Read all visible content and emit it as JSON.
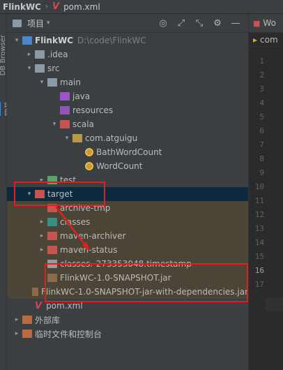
{
  "breadcrumb": {
    "project": "FlinkWC",
    "separator": "›",
    "file": "pom.xml"
  },
  "leftstrip": {
    "db_browser": "DB Browser",
    "project_tab": "项目"
  },
  "panel": {
    "title": "项目",
    "icons": [
      "target-icon",
      "expand-icon",
      "collapse-icon",
      "gear-icon",
      "hide-icon"
    ]
  },
  "tree": [
    {
      "arrow": "▾",
      "icon": "folder-blue",
      "label": "FlinkWC",
      "extra": "D:\\code\\FlinkWC",
      "bold": true,
      "indent": 0,
      "name": "tree-item-flinkwc"
    },
    {
      "arrow": "▸",
      "icon": "folder-grey",
      "label": ".idea",
      "indent": 1,
      "name": "tree-item-idea"
    },
    {
      "arrow": "▾",
      "icon": "folder-grey",
      "label": "src",
      "indent": 1,
      "name": "tree-item-src"
    },
    {
      "arrow": "▾",
      "icon": "folder-grey",
      "label": "main",
      "indent": 2,
      "name": "tree-item-main"
    },
    {
      "arrow": "",
      "icon": "folder-purple",
      "label": "java",
      "indent": 3,
      "name": "tree-item-java"
    },
    {
      "arrow": "",
      "icon": "folder-res",
      "label": "resources",
      "indent": 3,
      "name": "tree-item-resources"
    },
    {
      "arrow": "▾",
      "icon": "folder-red",
      "label": "scala",
      "indent": 3,
      "name": "tree-item-scala"
    },
    {
      "arrow": "▾",
      "icon": "pkg",
      "label": "com.atguigu",
      "indent": 4,
      "name": "tree-item-package"
    },
    {
      "arrow": "",
      "icon": "scala-cls",
      "label": "BathWordCount",
      "indent": 5,
      "name": "tree-item-bathwordcount"
    },
    {
      "arrow": "",
      "icon": "scala-cls",
      "label": "WordCount",
      "indent": 5,
      "name": "tree-item-wordcount"
    },
    {
      "arrow": "▸",
      "icon": "folder-green",
      "label": "test",
      "indent": 2,
      "name": "tree-item-test"
    },
    {
      "arrow": "▾",
      "icon": "folder-red",
      "label": "target",
      "indent": 1,
      "name": "tree-item-target",
      "selected": true
    },
    {
      "arrow": "",
      "icon": "folder-red",
      "label": "archive-tmp",
      "indent": 2,
      "name": "tree-item-archive-tmp",
      "excluded": true
    },
    {
      "arrow": "▸",
      "icon": "folder-teal",
      "label": "classes",
      "indent": 2,
      "name": "tree-item-classes",
      "excluded": true
    },
    {
      "arrow": "▸",
      "icon": "folder-red",
      "label": "maven-archiver",
      "indent": 2,
      "name": "tree-item-maven-archiver",
      "excluded": true
    },
    {
      "arrow": "▸",
      "icon": "folder-red",
      "label": "maven-status",
      "indent": 2,
      "name": "tree-item-maven-status",
      "excluded": true
    },
    {
      "arrow": "",
      "icon": "file",
      "label": "classes.-273353048.timestamp",
      "indent": 2,
      "name": "tree-item-timestamp",
      "excluded": true
    },
    {
      "arrow": "",
      "icon": "jar",
      "label": "FlinkWC-1.0-SNAPSHOT.jar",
      "indent": 2,
      "name": "tree-item-jar",
      "excluded": true
    },
    {
      "arrow": "",
      "icon": "jar",
      "label": "FlinkWC-1.0-SNAPSHOT-jar-with-dependencies.jar",
      "indent": 2,
      "name": "tree-item-jar-deps",
      "excluded": true
    },
    {
      "arrow": "",
      "icon": "maven",
      "label": "pom.xml",
      "indent": 1,
      "name": "tree-item-pom"
    },
    {
      "arrow": "▸",
      "icon": "ext",
      "label": "外部库",
      "indent": 0,
      "name": "tree-item-external-libs"
    },
    {
      "arrow": "▸",
      "icon": "ext",
      "label": "临时文件和控制台",
      "indent": 0,
      "name": "tree-item-scratches"
    }
  ],
  "editor": {
    "tab_label": "Wo",
    "breadcrumb": "com",
    "line_numbers": [
      "1",
      "2",
      "3",
      "4",
      "5",
      "6",
      "7",
      "8",
      "9",
      "10",
      "11",
      "12",
      "13",
      "14",
      "15",
      "16",
      "17"
    ],
    "current_line": "16"
  },
  "colors": {
    "annotation": "#e02020",
    "selection": "#0d293e",
    "excluded": "#4a4536"
  }
}
